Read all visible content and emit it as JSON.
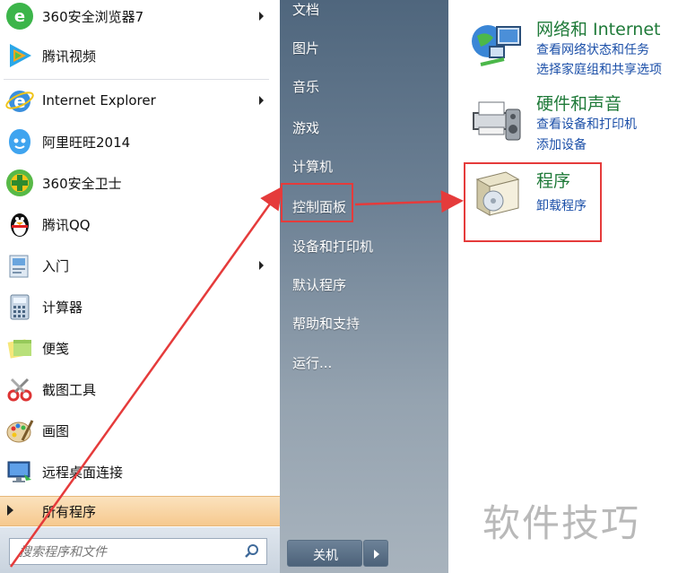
{
  "programs": [
    {
      "label": "360安全浏览器7",
      "icon": "360-browser-icon",
      "submenu": true
    },
    {
      "label": "腾讯视频",
      "icon": "tencent-video-icon",
      "submenu": false
    },
    {
      "label": "Internet Explorer",
      "icon": "internet-explorer-icon",
      "submenu": true
    },
    {
      "label": "阿里旺旺2014",
      "icon": "aliwangwang-icon",
      "submenu": false
    },
    {
      "label": "360安全卫士",
      "icon": "360-safeguard-icon",
      "submenu": false
    },
    {
      "label": "腾讯QQ",
      "icon": "qq-penguin-icon",
      "submenu": false
    },
    {
      "label": "入门",
      "icon": "getting-started-icon",
      "submenu": true
    },
    {
      "label": "计算器",
      "icon": "calculator-icon",
      "submenu": false
    },
    {
      "label": "便笺",
      "icon": "sticky-notes-icon",
      "submenu": false
    },
    {
      "label": "截图工具",
      "icon": "snipping-tool-icon",
      "submenu": false
    },
    {
      "label": "画图",
      "icon": "paint-icon",
      "submenu": false
    },
    {
      "label": "远程桌面连接",
      "icon": "remote-desktop-icon",
      "submenu": false
    }
  ],
  "all_programs": {
    "label": "所有程序"
  },
  "search": {
    "placeholder": "搜索程序和文件"
  },
  "right_menu": {
    "documents": "文档",
    "pictures": "图片",
    "music": "音乐",
    "games": "游戏",
    "computer": "计算机",
    "control_panel": "控制面板",
    "devices_printers": "设备和打印机",
    "default_programs": "默认程序",
    "help_support": "帮助和支持",
    "run": "运行..."
  },
  "shutdown": {
    "label": "关机"
  },
  "control_panel_items": {
    "network": {
      "title": "网络和 Internet",
      "link1": "查看网络状态和任务",
      "link2": "选择家庭组和共享选项"
    },
    "hardware": {
      "title": "硬件和声音",
      "link1": "查看设备和打印机",
      "link2": "添加设备"
    },
    "programs": {
      "title": "程序",
      "link1": "卸载程序"
    }
  },
  "watermark": {
    "text": "软件技巧"
  },
  "colors": {
    "highlight": "#e53b3b",
    "cp_title": "#1f7a39",
    "cp_link": "#1b4fa8",
    "menu_blue": "#5b7086"
  }
}
